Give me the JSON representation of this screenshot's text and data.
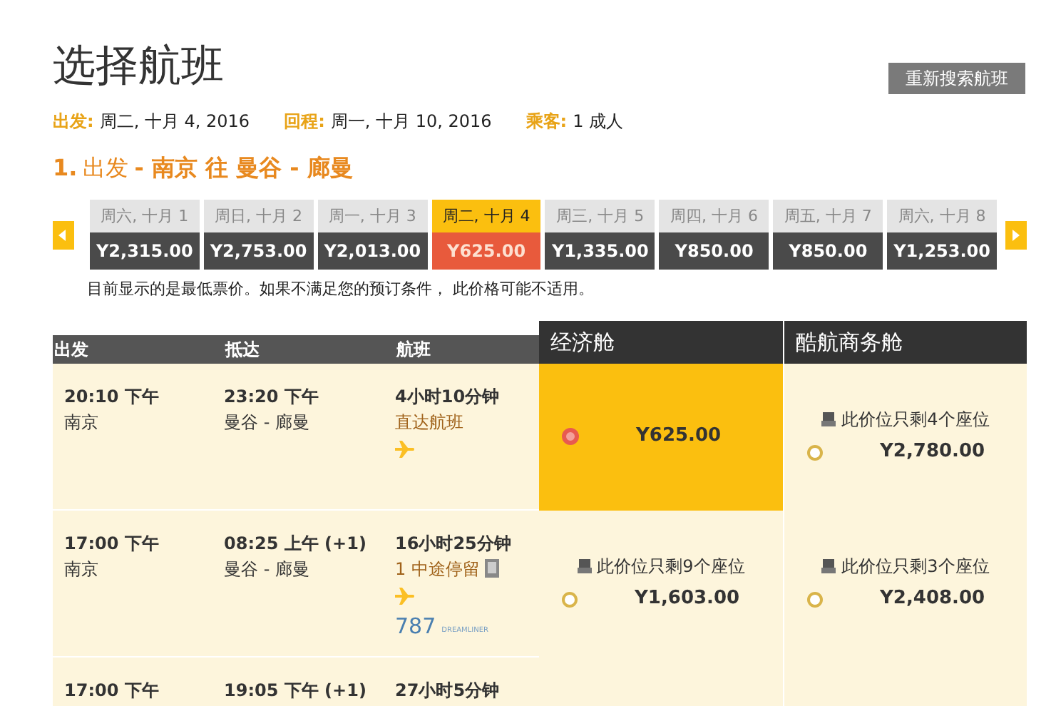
{
  "page_title": "选择航班",
  "search_again_button": "重新搜索航班",
  "trip_info": [
    {
      "label": "出发:",
      "value": "周二, 十月 4, 2016"
    },
    {
      "label": "回程:",
      "value": "周一, 十月 10, 2016"
    },
    {
      "label": "乘客:",
      "value": "1 成人"
    }
  ],
  "section": {
    "number": "1.",
    "leg": "出发",
    "route": "- 南京 往 曼谷 - 廊曼"
  },
  "date_strip": [
    {
      "date": "周六, 十月 1",
      "price": "Y2,315.00",
      "selected": false
    },
    {
      "date": "周日, 十月 2",
      "price": "Y2,753.00",
      "selected": false
    },
    {
      "date": "周一, 十月 3",
      "price": "Y2,013.00",
      "selected": false
    },
    {
      "date": "周二, 十月 4",
      "price": "Y625.00",
      "selected": true
    },
    {
      "date": "周三, 十月 5",
      "price": "Y1,335.00",
      "selected": false
    },
    {
      "date": "周四, 十月 6",
      "price": "Y850.00",
      "selected": false
    },
    {
      "date": "周五, 十月 7",
      "price": "Y850.00",
      "selected": false
    },
    {
      "date": "周六, 十月 8",
      "price": "Y1,253.00",
      "selected": false
    }
  ],
  "price_note": "目前显示的是最低票价。如果不满足您的预订条件， 此价格可能不适用。",
  "table": {
    "columns": [
      "出发",
      "抵达",
      "航班"
    ],
    "fare_columns": [
      "经济舱",
      "酷航商务舱"
    ],
    "rows": [
      {
        "depart_time": "20:10 下午",
        "depart_city": "南京",
        "arrive_time": "23:20 下午",
        "arrive_city": "曼谷 - 廊曼",
        "duration": "4小时10分钟",
        "stops": "直达航班",
        "has_stop_info": false,
        "fares": [
          {
            "price": "Y625.00",
            "selected": true
          },
          {
            "seats": "此价位只剩4个座位",
            "price": "Y2,780.00",
            "selected": false
          }
        ]
      },
      {
        "depart_time": "17:00 下午",
        "depart_city": "南京",
        "arrive_time": "08:25 上午 (+1)",
        "arrive_city": "曼谷 - 廊曼",
        "duration": "16小时25分钟",
        "stops": "1 中途停留",
        "has_stop_info": true,
        "aircraft": {
          "number": "787",
          "name": "DREAMLINER"
        },
        "fares": [
          {
            "seats": "此价位只剩9个座位",
            "price": "Y1,603.00",
            "selected": false
          },
          {
            "seats": "此价位只剩3个座位",
            "price": "Y2,408.00",
            "selected": false
          }
        ]
      },
      {
        "depart_time": "17:00 下午",
        "arrive_time": "19:05 下午 (+1)",
        "duration": "27小时5分钟",
        "fares": []
      }
    ]
  }
}
